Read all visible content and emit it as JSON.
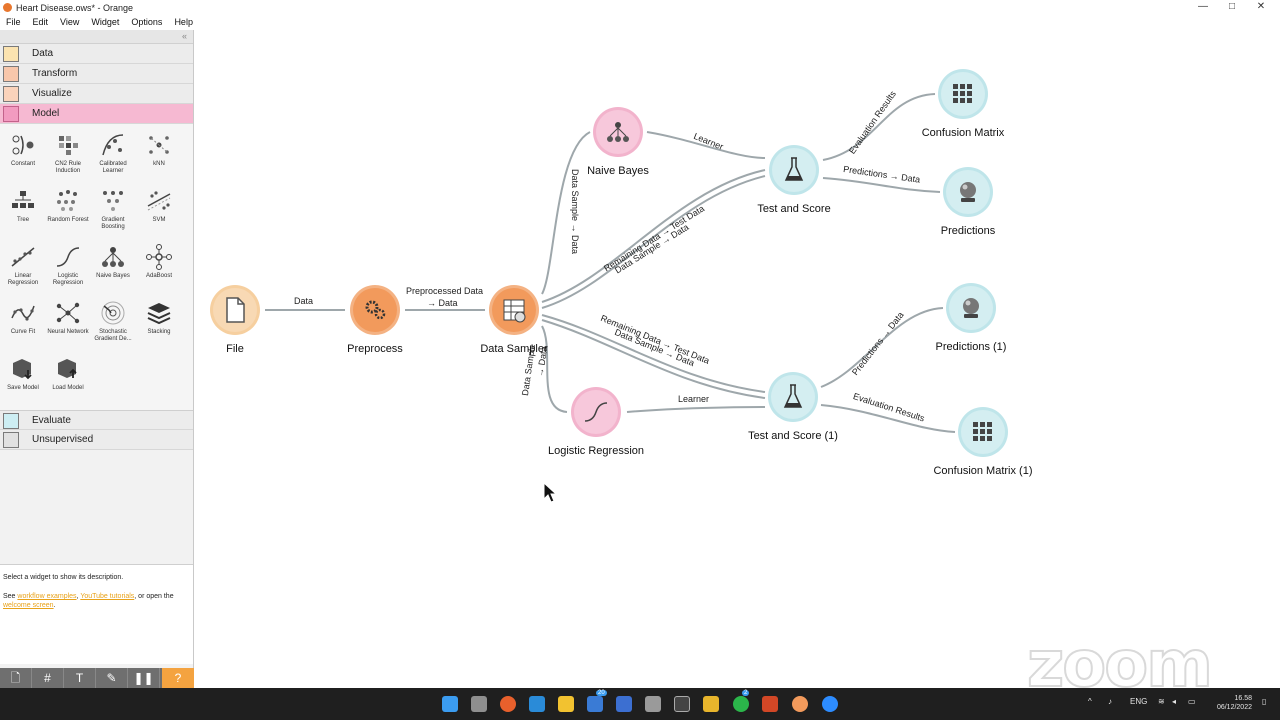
{
  "window": {
    "title": "Heart Disease.ows* - Orange",
    "controls": [
      "—",
      "□",
      "✕"
    ]
  },
  "menu": [
    "File",
    "Edit",
    "View",
    "Widget",
    "Options",
    "Help"
  ],
  "categories": [
    {
      "label": "Data",
      "color": "#f4c96a"
    },
    {
      "label": "Transform",
      "color": "#f4a07a"
    },
    {
      "label": "Visualize",
      "color": "#f7b58c"
    },
    {
      "label": "Model",
      "color": "#f29bc0",
      "active": true
    }
  ],
  "model_widgets": [
    "Constant",
    "CN2 Rule Induction",
    "Calibrated Learner",
    "kNN",
    "Tree",
    "Random Forest",
    "Gradient Boosting",
    "SVM",
    "Linear Regression",
    "Logistic Regression",
    "Naive Bayes",
    "AdaBoost",
    "Curve Fit",
    "Neural Network",
    "Stochastic Gradient De...",
    "Stacking",
    "Save Model",
    "Load Model"
  ],
  "categories_after": [
    {
      "label": "Evaluate",
      "color": "#a8dde6"
    },
    {
      "label": "Unsupervised",
      "color": "#c3c3c3"
    }
  ],
  "description": {
    "line1": "Select a widget to show its description.",
    "see": "See ",
    "link1": "workflow examples",
    "comma": ", ",
    "link2": "YouTube tutorials",
    "or": ", or open the ",
    "link3": "welcome screen",
    "dot": "."
  },
  "toolbar": [
    "🗋",
    "#",
    "T",
    "✎",
    "❚❚",
    "?"
  ],
  "nodes": [
    {
      "id": "file",
      "caption": "File",
      "color": "#f8d9b4",
      "ring": "#f2c28e"
    },
    {
      "id": "preprocess",
      "caption": "Preprocess",
      "color": "#f29a5c",
      "ring": "#e8772e"
    },
    {
      "id": "sampler",
      "caption": "Data Sampler",
      "color": "#f29a5c",
      "ring": "#e8772e"
    },
    {
      "id": "nb",
      "caption": "Naive Bayes",
      "color": "#f7c8db",
      "ring": "#ec9bbd"
    },
    {
      "id": "lr",
      "caption": "Logistic Regression",
      "color": "#f7c8db",
      "ring": "#ec9bbd"
    },
    {
      "id": "ts",
      "caption": "Test and Score",
      "color": "#d4eef1",
      "ring": "#a8dde6"
    },
    {
      "id": "ts1",
      "caption": "Test and Score (1)",
      "color": "#d4eef1",
      "ring": "#a8dde6"
    },
    {
      "id": "cm",
      "caption": "Confusion Matrix",
      "color": "#d4eef1",
      "ring": "#a8dde6"
    },
    {
      "id": "pred",
      "caption": "Predictions",
      "color": "#d4eef1",
      "ring": "#a8dde6"
    },
    {
      "id": "pred1",
      "caption": "Predictions (1)",
      "color": "#d4eef1",
      "ring": "#a8dde6"
    },
    {
      "id": "cm1",
      "caption": "Confusion Matrix (1)",
      "color": "#d4eef1",
      "ring": "#a8dde6"
    }
  ],
  "link_labels": {
    "file_pre": "Data",
    "pre_sampler_1": "Preprocessed Data",
    "pre_sampler_2": "→ Data",
    "sampler_nb": "Data Sample → Data",
    "sampler_ts_a": "Remaining Data → Test Data",
    "sampler_ts_b": "Data Sample → Data",
    "sampler_ts1_a": "Remaining Data → Test Data",
    "sampler_ts1_b": "Data Sample → Data",
    "sampler_lr_a": "Data Sample",
    "sampler_lr_b": "→ Data",
    "nb_ts": "Learner",
    "lr_ts1": "Learner",
    "ts_cm": "Evaluation Results",
    "ts_pred": "Predictions → Data",
    "ts1_pred1": "Predictions → Data",
    "ts1_cm1": "Evaluation Results"
  },
  "watermark": "zoom",
  "tray": {
    "lang": "ENG",
    "time": "16.58",
    "date": "06/12/2022",
    "badge1": "20",
    "badge2": "2"
  }
}
